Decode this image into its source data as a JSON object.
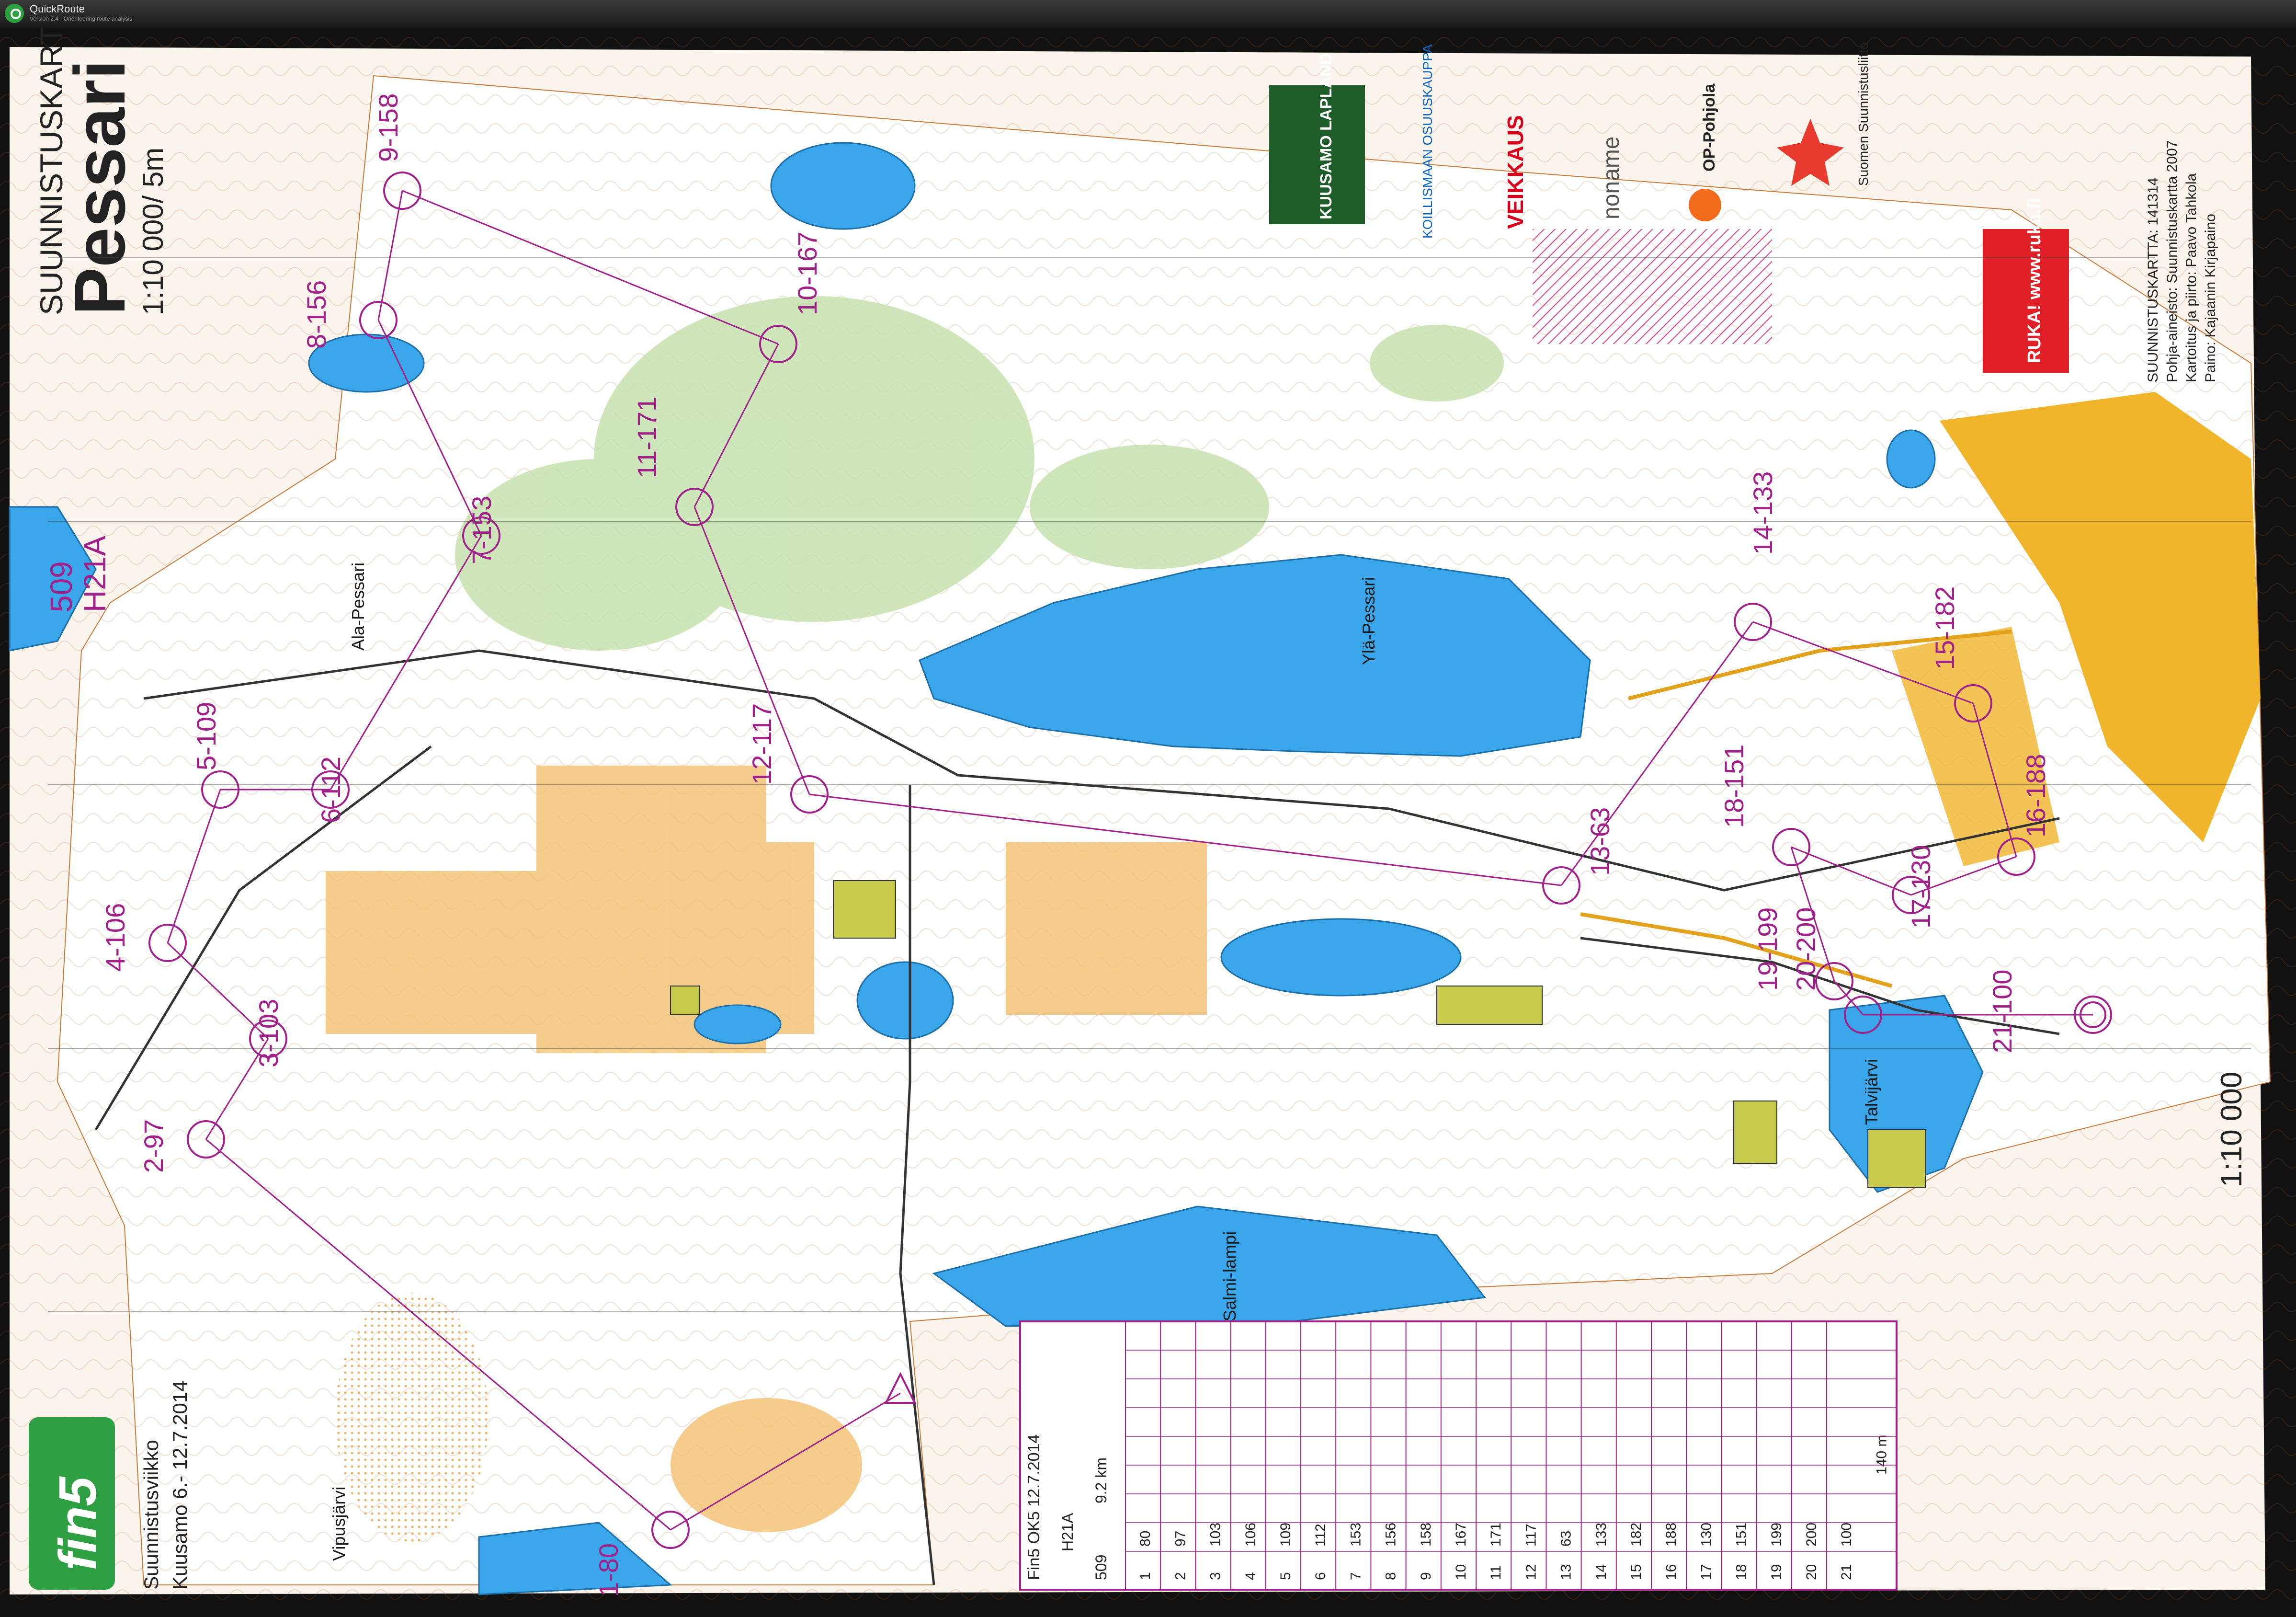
{
  "window": {
    "app_name": "QuickRoute",
    "subtitle": "Version 2.4 · Orienteering route analysis"
  },
  "map": {
    "header_small": "SUUNNISTUSKARTTA",
    "name": "Pessari",
    "scale_line": "1:10 000/ 5m",
    "course_code": "509",
    "class": "H21A",
    "scale_right": "1:10 000",
    "event_line1": "Suunnistusviikko",
    "event_line2": "Kuusamo 6.- 12.7.2014",
    "fin5_logo": "fin5",
    "credits": [
      "SUUNNISTUSKARTTA: 141314",
      "Pohja-aineisto: Suunnistuskartta 2007",
      "Kartoitus ja piirto: Paavo Tahkola",
      "Paino: Kajaanin Kirjapaino"
    ],
    "sponsors": [
      "KUUSAMO LAPLAND",
      "KOILLISMAAN OSUUSKAUPPA",
      "VEIKKAUS",
      "noname",
      "OP-Pohjola",
      "Suomen Suunnistusliitto",
      "RUKA! www.ruka.fi"
    ],
    "lake_names": [
      "Ala-Pessari",
      "Ylä-Pessari",
      "Talvijärvi",
      "Salmi-lampi",
      "Vipusjärvi"
    ],
    "controls": [
      {
        "label": "1-80"
      },
      {
        "label": "2-97"
      },
      {
        "label": "3-103"
      },
      {
        "label": "4-106"
      },
      {
        "label": "5-109"
      },
      {
        "label": "6-112"
      },
      {
        "label": "7-153"
      },
      {
        "label": "8-156"
      },
      {
        "label": "9-158"
      },
      {
        "label": "10-167"
      },
      {
        "label": "11-171"
      },
      {
        "label": "12-117"
      },
      {
        "label": "13-63"
      },
      {
        "label": "14-133"
      },
      {
        "label": "15-182"
      },
      {
        "label": "16-188"
      },
      {
        "label": "17-130"
      },
      {
        "label": "18-151"
      },
      {
        "label": "19-199"
      },
      {
        "label": "20-200"
      },
      {
        "label": "21-100"
      }
    ],
    "description_sheet": {
      "header": "Fin5 OK5 12.7.2014",
      "class": "H21A",
      "course": "509",
      "length": "9.2 km",
      "rows": [
        {
          "n": "1",
          "code": "80"
        },
        {
          "n": "2",
          "code": "97"
        },
        {
          "n": "3",
          "code": "103"
        },
        {
          "n": "4",
          "code": "106"
        },
        {
          "n": "5",
          "code": "109"
        },
        {
          "n": "6",
          "code": "112"
        },
        {
          "n": "7",
          "code": "153"
        },
        {
          "n": "8",
          "code": "156"
        },
        {
          "n": "9",
          "code": "158"
        },
        {
          "n": "10",
          "code": "167"
        },
        {
          "n": "11",
          "code": "171"
        },
        {
          "n": "12",
          "code": "117"
        },
        {
          "n": "13",
          "code": "63"
        },
        {
          "n": "14",
          "code": "133"
        },
        {
          "n": "15",
          "code": "182"
        },
        {
          "n": "16",
          "code": "188"
        },
        {
          "n": "17",
          "code": "130"
        },
        {
          "n": "18",
          "code": "151"
        },
        {
          "n": "19",
          "code": "199"
        },
        {
          "n": "20",
          "code": "200"
        },
        {
          "n": "21",
          "code": "100"
        }
      ],
      "finish_distance": "140 m"
    },
    "colors": {
      "course": "#a0218a",
      "water": "#3aa5e8",
      "open_land": "#f7c87a",
      "forest": "#ffffff",
      "green": "#bfe0a8",
      "contour": "#b0622a",
      "paper": "#fbf4ec"
    }
  }
}
